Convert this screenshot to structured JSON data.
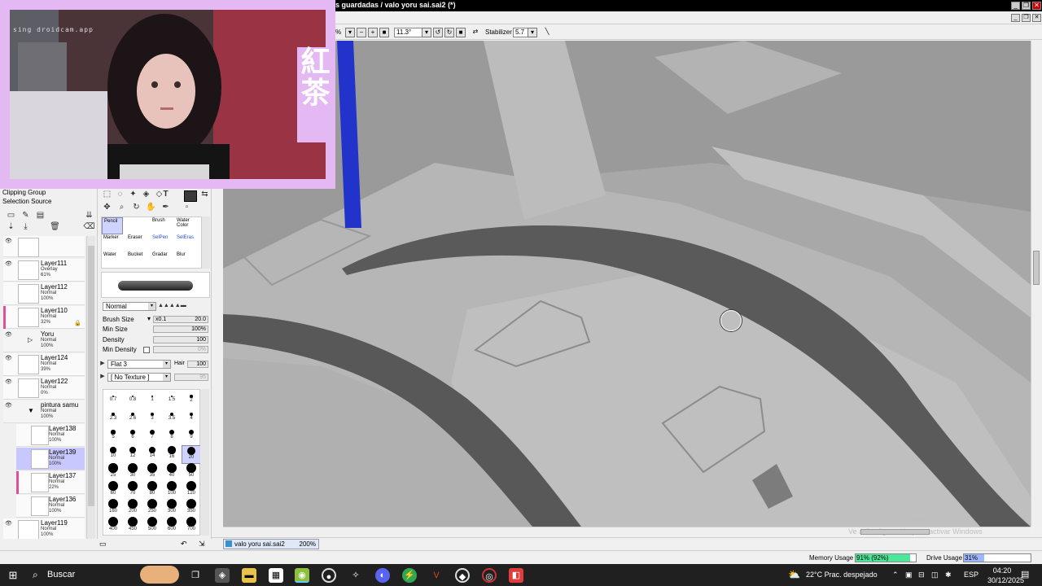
{
  "window": {
    "title": "s guardadas / valo yoru sai.sai2 (*)"
  },
  "toolbar": {
    "zoom_suffix": "%",
    "rotation": "11.3°",
    "stabilizer_label": "Stabilizer",
    "stabilizer_value": "5.7"
  },
  "webcam": {
    "watermark": "sing droidcam.app",
    "kanji": [
      "紅",
      "茶"
    ]
  },
  "layers": {
    "clipping_group": "Clipping Group",
    "selection_source": "Selection Source",
    "items": [
      {
        "name": "Layer111",
        "mode": "Overlay",
        "opacity": "61%"
      },
      {
        "name": "Layer112",
        "mode": "Normal",
        "opacity": "100%"
      },
      {
        "name": "Layer110",
        "mode": "Normal",
        "opacity": "32%"
      },
      {
        "name": "Yoru",
        "mode": "Normal",
        "opacity": "100%"
      },
      {
        "name": "Layer124",
        "mode": "Normal",
        "opacity": "39%"
      },
      {
        "name": "Layer122",
        "mode": "Normal",
        "opacity": "0%"
      },
      {
        "name": "pintura samu",
        "mode": "Normal",
        "opacity": "100%"
      },
      {
        "name": "Layer138",
        "mode": "Normal",
        "opacity": "100%"
      },
      {
        "name": "Layer139",
        "mode": "Normal",
        "opacity": "100%"
      },
      {
        "name": "Layer137",
        "mode": "Normal",
        "opacity": "22%"
      },
      {
        "name": "Layer136",
        "mode": "Normal",
        "opacity": "100%"
      },
      {
        "name": "Layer119",
        "mode": "Normal",
        "opacity": "100%"
      }
    ]
  },
  "tools": {
    "brushes": [
      {
        "label": "Pencil",
        "sub": ""
      },
      {
        "label": "",
        "sub": ""
      },
      {
        "label": "Brush",
        "sub": ""
      },
      {
        "label": "Water Color",
        "sub": ""
      },
      {
        "label": "Marker",
        "sub": ""
      },
      {
        "label": "Eraser",
        "sub": ""
      },
      {
        "label": "SelPen",
        "sub": ""
      },
      {
        "label": "SelEras",
        "sub": ""
      },
      {
        "label": "Water",
        "sub": ""
      },
      {
        "label": "Bucket",
        "sub": ""
      },
      {
        "label": "Gradar",
        "sub": ""
      },
      {
        "label": "Blur",
        "sub": ""
      }
    ],
    "blend_mode": "Normal",
    "brush_size_label": "Brush Size",
    "brush_size_mult": "x0.1",
    "brush_size_value": "20.0",
    "min_size_label": "Min Size",
    "min_size_value": "100%",
    "density_label": "Density",
    "density_value": "100",
    "min_density_label": "Min Density",
    "min_density_value": "0%",
    "shape": "Flat 3",
    "hair_label": "Hair",
    "hair_value": "100",
    "texture": "[ No Texture ]",
    "texture_value": "95",
    "sizes": [
      "0.7",
      "0.8",
      "1",
      "1.5",
      "2",
      "2.3",
      "2.6",
      "3",
      "3.5",
      "4",
      "5",
      "6",
      "7",
      "8",
      "9",
      "10",
      "12",
      "14",
      "16",
      "20",
      "25",
      "30",
      "35",
      "40",
      "50",
      "60",
      "70",
      "80",
      "100",
      "120",
      "160",
      "200",
      "250",
      "300",
      "350",
      "400",
      "450",
      "500",
      "600",
      "700"
    ],
    "selected_size": "20"
  },
  "canvas": {
    "watermark_1": "dows",
    "watermark_2": "Ve a Configuración para activar Windows"
  },
  "document_tab": {
    "name": "valo yoru sai.sai2",
    "zoom": "200%"
  },
  "status": {
    "memory_label": "Memory Usage",
    "memory_value": "91% (92%)",
    "drive_label": "Drive Usage",
    "drive_value": "31%"
  },
  "taskbar": {
    "search_placeholder": "Buscar",
    "weather": "22°C  Prac. despejado",
    "language": "ESP",
    "time": "04:20",
    "date": "30/12/2025"
  },
  "colors": {
    "accent_purple": "#e3b8f3",
    "memory_fill": "#4de79a",
    "drive_fill": "#9db8ff",
    "selection_blue": "#c8c8ff"
  }
}
